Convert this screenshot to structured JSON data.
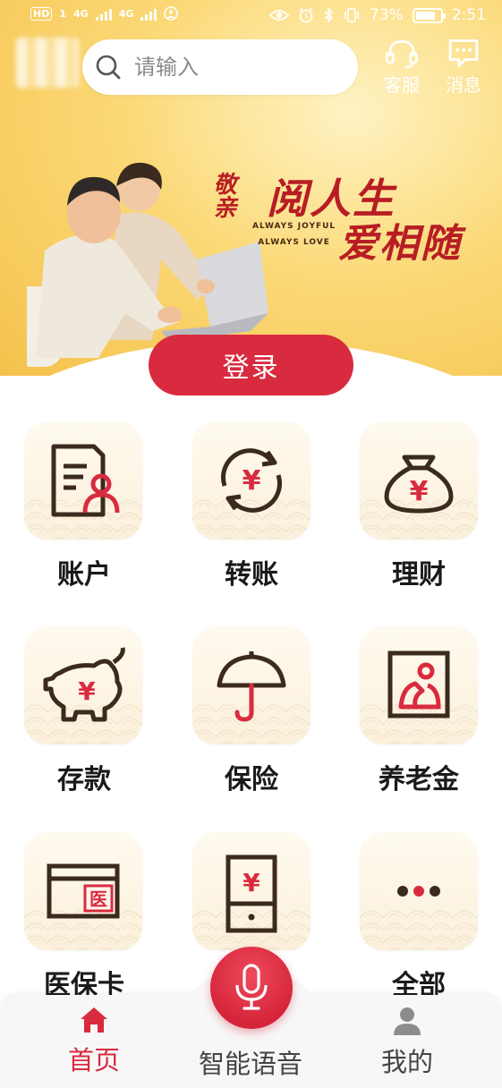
{
  "status_bar": {
    "left_labels": [
      "HD",
      "1",
      "4G",
      "4G"
    ],
    "battery": "73%",
    "time": "2:51"
  },
  "header": {
    "search_placeholder": "请输入",
    "service_label": "客服",
    "message_label": "消息"
  },
  "banner": {
    "stamp_text": "敬亲",
    "title_line1": "阅人生",
    "title_line2": "爱相随",
    "slogan_line1": "ALWAYS JOYFUL",
    "slogan_line2": "ALWAYS LOVE"
  },
  "login_label": "登录",
  "grid": {
    "items": [
      {
        "label": "账户",
        "icon": "account-icon"
      },
      {
        "label": "转账",
        "icon": "transfer-icon",
        "glyph": "¥"
      },
      {
        "label": "理财",
        "icon": "wealth-bag-icon",
        "glyph": "¥"
      },
      {
        "label": "存款",
        "icon": "piggy-bank-icon",
        "glyph": "¥"
      },
      {
        "label": "保险",
        "icon": "umbrella-icon"
      },
      {
        "label": "养老金",
        "icon": "pension-portrait-icon"
      },
      {
        "label": "医保卡",
        "icon": "medical-card-icon",
        "glyph": "医"
      },
      {
        "label": "",
        "icon": "phone-yuan-icon",
        "glyph": "¥"
      },
      {
        "label": "全部",
        "icon": "more-dots-icon"
      }
    ]
  },
  "bottom_nav": {
    "home_label": "首页",
    "voice_label": "智能语音",
    "mine_label": "我的"
  },
  "colors": {
    "accent_red": "#d92b3f",
    "banner_gold": "#f4c24c",
    "icon_dark": "#3b2a1e",
    "tile_bg": "#fbf0db"
  }
}
